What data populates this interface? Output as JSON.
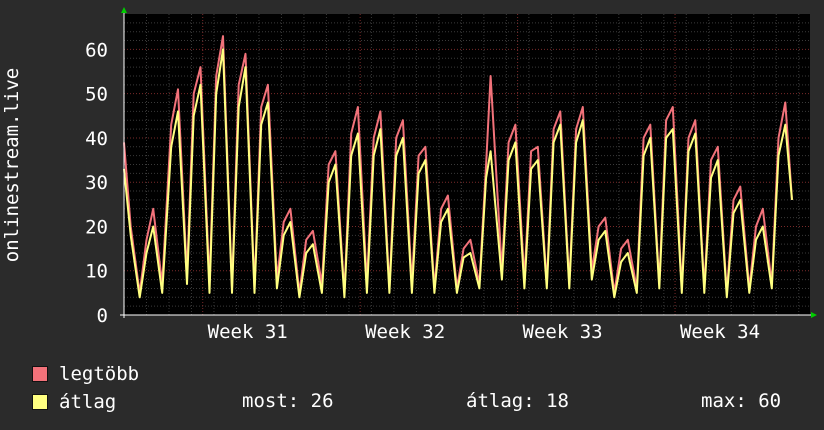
{
  "chart_data": {
    "type": "line",
    "ylabel": "onlinestream.live",
    "ylim": [
      0,
      68
    ],
    "yticks": [
      0,
      10,
      20,
      30,
      40,
      50,
      60
    ],
    "x_tick_labels": [
      "Week 31",
      "Week 32",
      "Week 33",
      "Week 34"
    ],
    "x_tick_days": [
      5.5,
      12.5,
      19.5,
      26.5
    ],
    "x_range_days": [
      0,
      30.5
    ],
    "grid": true,
    "series": [
      {
        "name": "legtöbb",
        "color": "#f2727a",
        "points": [
          [
            0.0,
            39
          ],
          [
            0.3,
            20
          ],
          [
            0.7,
            5
          ],
          [
            1.0,
            17
          ],
          [
            1.3,
            24
          ],
          [
            1.7,
            7
          ],
          [
            2.1,
            43
          ],
          [
            2.4,
            51
          ],
          [
            2.8,
            9
          ],
          [
            3.1,
            50
          ],
          [
            3.4,
            56
          ],
          [
            3.8,
            7
          ],
          [
            4.1,
            54
          ],
          [
            4.4,
            63
          ],
          [
            4.8,
            6
          ],
          [
            5.1,
            52
          ],
          [
            5.4,
            59
          ],
          [
            5.8,
            6
          ],
          [
            6.1,
            47
          ],
          [
            6.4,
            52
          ],
          [
            6.8,
            8
          ],
          [
            7.1,
            21
          ],
          [
            7.4,
            24
          ],
          [
            7.8,
            5
          ],
          [
            8.1,
            17
          ],
          [
            8.4,
            19
          ],
          [
            8.8,
            7
          ],
          [
            9.1,
            34
          ],
          [
            9.4,
            37
          ],
          [
            9.8,
            5
          ],
          [
            10.1,
            41
          ],
          [
            10.4,
            47
          ],
          [
            10.8,
            7
          ],
          [
            11.1,
            40
          ],
          [
            11.4,
            46
          ],
          [
            11.8,
            6
          ],
          [
            12.1,
            40
          ],
          [
            12.4,
            44
          ],
          [
            12.8,
            7
          ],
          [
            13.1,
            36
          ],
          [
            13.4,
            38
          ],
          [
            13.8,
            6
          ],
          [
            14.1,
            24
          ],
          [
            14.4,
            27
          ],
          [
            14.8,
            6
          ],
          [
            15.1,
            15
          ],
          [
            15.4,
            17
          ],
          [
            15.8,
            7
          ],
          [
            16.1,
            34
          ],
          [
            16.3,
            54
          ],
          [
            16.8,
            10
          ],
          [
            17.1,
            39
          ],
          [
            17.4,
            43
          ],
          [
            17.8,
            8
          ],
          [
            18.1,
            37
          ],
          [
            18.4,
            38
          ],
          [
            18.8,
            7
          ],
          [
            19.1,
            42
          ],
          [
            19.4,
            46
          ],
          [
            19.8,
            7
          ],
          [
            20.1,
            42
          ],
          [
            20.4,
            47
          ],
          [
            20.8,
            10
          ],
          [
            21.1,
            20
          ],
          [
            21.4,
            22
          ],
          [
            21.8,
            5
          ],
          [
            22.1,
            15
          ],
          [
            22.4,
            17
          ],
          [
            22.8,
            6
          ],
          [
            23.1,
            40
          ],
          [
            23.4,
            43
          ],
          [
            23.8,
            7
          ],
          [
            24.1,
            44
          ],
          [
            24.4,
            47
          ],
          [
            24.8,
            6
          ],
          [
            25.1,
            40
          ],
          [
            25.4,
            44
          ],
          [
            25.8,
            6
          ],
          [
            26.1,
            35
          ],
          [
            26.4,
            38
          ],
          [
            26.8,
            5
          ],
          [
            27.1,
            26
          ],
          [
            27.4,
            29
          ],
          [
            27.8,
            6
          ],
          [
            28.1,
            20
          ],
          [
            28.4,
            24
          ],
          [
            28.8,
            7
          ],
          [
            29.1,
            40
          ],
          [
            29.4,
            48
          ],
          [
            29.7,
            26
          ]
        ]
      },
      {
        "name": "átlag",
        "color": "#ffff80",
        "points": [
          [
            0.0,
            33
          ],
          [
            0.3,
            18
          ],
          [
            0.7,
            4
          ],
          [
            1.0,
            14
          ],
          [
            1.3,
            20
          ],
          [
            1.7,
            5
          ],
          [
            2.1,
            38
          ],
          [
            2.4,
            46
          ],
          [
            2.8,
            7
          ],
          [
            3.1,
            45
          ],
          [
            3.4,
            52
          ],
          [
            3.8,
            5
          ],
          [
            4.1,
            50
          ],
          [
            4.4,
            60
          ],
          [
            4.8,
            5
          ],
          [
            5.1,
            47
          ],
          [
            5.4,
            56
          ],
          [
            5.8,
            5
          ],
          [
            6.1,
            43
          ],
          [
            6.4,
            48
          ],
          [
            6.8,
            6
          ],
          [
            7.1,
            18
          ],
          [
            7.4,
            21
          ],
          [
            7.8,
            4
          ],
          [
            8.1,
            14
          ],
          [
            8.4,
            16
          ],
          [
            8.8,
            5
          ],
          [
            9.1,
            30
          ],
          [
            9.4,
            34
          ],
          [
            9.8,
            4
          ],
          [
            10.1,
            36
          ],
          [
            10.4,
            41
          ],
          [
            10.8,
            5
          ],
          [
            11.1,
            36
          ],
          [
            11.4,
            42
          ],
          [
            11.8,
            5
          ],
          [
            12.1,
            36
          ],
          [
            12.4,
            40
          ],
          [
            12.8,
            5
          ],
          [
            13.1,
            32
          ],
          [
            13.4,
            35
          ],
          [
            13.8,
            5
          ],
          [
            14.1,
            21
          ],
          [
            14.4,
            24
          ],
          [
            14.8,
            5
          ],
          [
            15.1,
            13
          ],
          [
            15.4,
            14
          ],
          [
            15.8,
            6
          ],
          [
            16.1,
            31
          ],
          [
            16.3,
            37
          ],
          [
            16.8,
            8
          ],
          [
            17.1,
            35
          ],
          [
            17.4,
            39
          ],
          [
            17.8,
            6
          ],
          [
            18.1,
            33
          ],
          [
            18.4,
            35
          ],
          [
            18.8,
            6
          ],
          [
            19.1,
            39
          ],
          [
            19.4,
            43
          ],
          [
            19.8,
            6
          ],
          [
            20.1,
            39
          ],
          [
            20.4,
            44
          ],
          [
            20.8,
            8
          ],
          [
            21.1,
            17
          ],
          [
            21.4,
            19
          ],
          [
            21.8,
            4
          ],
          [
            22.1,
            12
          ],
          [
            22.4,
            14
          ],
          [
            22.8,
            5
          ],
          [
            23.1,
            36
          ],
          [
            23.4,
            40
          ],
          [
            23.8,
            6
          ],
          [
            24.1,
            40
          ],
          [
            24.4,
            42
          ],
          [
            24.8,
            5
          ],
          [
            25.1,
            37
          ],
          [
            25.4,
            41
          ],
          [
            25.8,
            5
          ],
          [
            26.1,
            31
          ],
          [
            26.4,
            35
          ],
          [
            26.8,
            4
          ],
          [
            27.1,
            23
          ],
          [
            27.4,
            26
          ],
          [
            27.8,
            5
          ],
          [
            28.1,
            17
          ],
          [
            28.4,
            20
          ],
          [
            28.8,
            6
          ],
          [
            29.1,
            36
          ],
          [
            29.4,
            43
          ],
          [
            29.7,
            26
          ]
        ]
      }
    ]
  },
  "legend": [
    {
      "label": "legtöbb",
      "color": "#f2727a"
    },
    {
      "label": "átlag",
      "color": "#ffff80"
    }
  ],
  "stats": {
    "most": "most: 26",
    "atlag": "átlag: 18",
    "max": "max: 60"
  }
}
